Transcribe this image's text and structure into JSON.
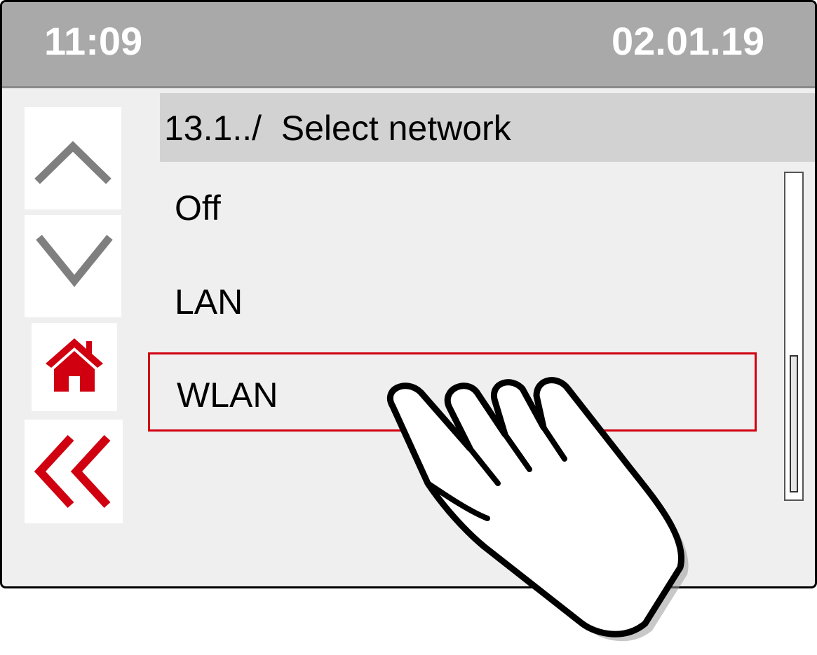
{
  "status": {
    "time": "11:09",
    "date": "02.01.19"
  },
  "nav": {
    "up_icon": "chevron-up-icon",
    "down_icon": "chevron-down-icon",
    "home_icon": "home-icon",
    "back_icon": "double-chevron-left-icon"
  },
  "menu": {
    "header": "13.1../  Select network",
    "items": [
      {
        "label": "Off"
      },
      {
        "label": "LAN"
      },
      {
        "label": "WLAN",
        "selected": true
      }
    ]
  },
  "colors": {
    "accent": "#d00010",
    "statusbar": "#a9a9a9",
    "header_bg": "#d2d2d2",
    "screen_bg": "#efefef",
    "arrow_gray": "#7f7f7f"
  }
}
